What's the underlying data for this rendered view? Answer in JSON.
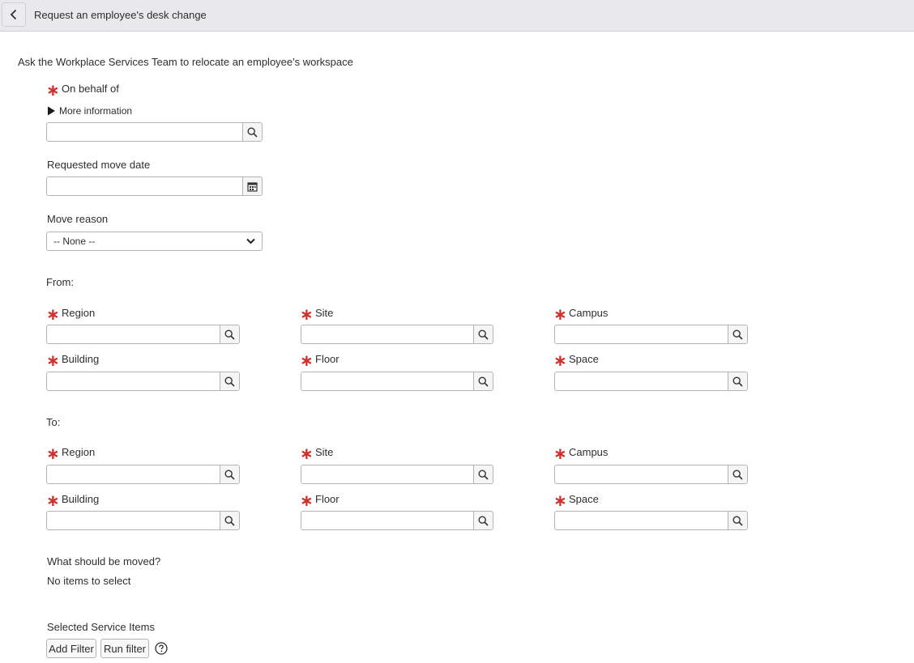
{
  "header": {
    "title": "Request an employee's desk change"
  },
  "description": "Ask the Workplace Services Team to relocate an employee's workspace",
  "on_behalf_of": {
    "label": "On behalf of",
    "more_info": "More information",
    "value": ""
  },
  "move_date": {
    "label": "Requested move date",
    "value": ""
  },
  "move_reason": {
    "label": "Move reason",
    "selected": "-- None --"
  },
  "from": {
    "heading": "From:",
    "region": "Region",
    "site": "Site",
    "campus": "Campus",
    "building": "Building",
    "floor": "Floor",
    "space": "Space"
  },
  "to": {
    "heading": "To:",
    "region": "Region",
    "site": "Site",
    "campus": "Campus",
    "building": "Building",
    "floor": "Floor",
    "space": "Space"
  },
  "items": {
    "label": "What should be moved?",
    "empty_text": "No items to select"
  },
  "service_items": {
    "label": "Selected Service Items",
    "add_filter": "Add Filter",
    "run_filter": "Run filter"
  },
  "colors": {
    "required": "#d0312d",
    "header_bg": "#e9e9eb",
    "border": "#b4b4b8"
  },
  "icons": {
    "back": "chevron-left-icon",
    "lookup": "search-icon",
    "calendar": "calendar-icon",
    "dropdown": "chevron-down-icon",
    "expand": "triangle-right-icon",
    "help": "question-circle-icon"
  }
}
